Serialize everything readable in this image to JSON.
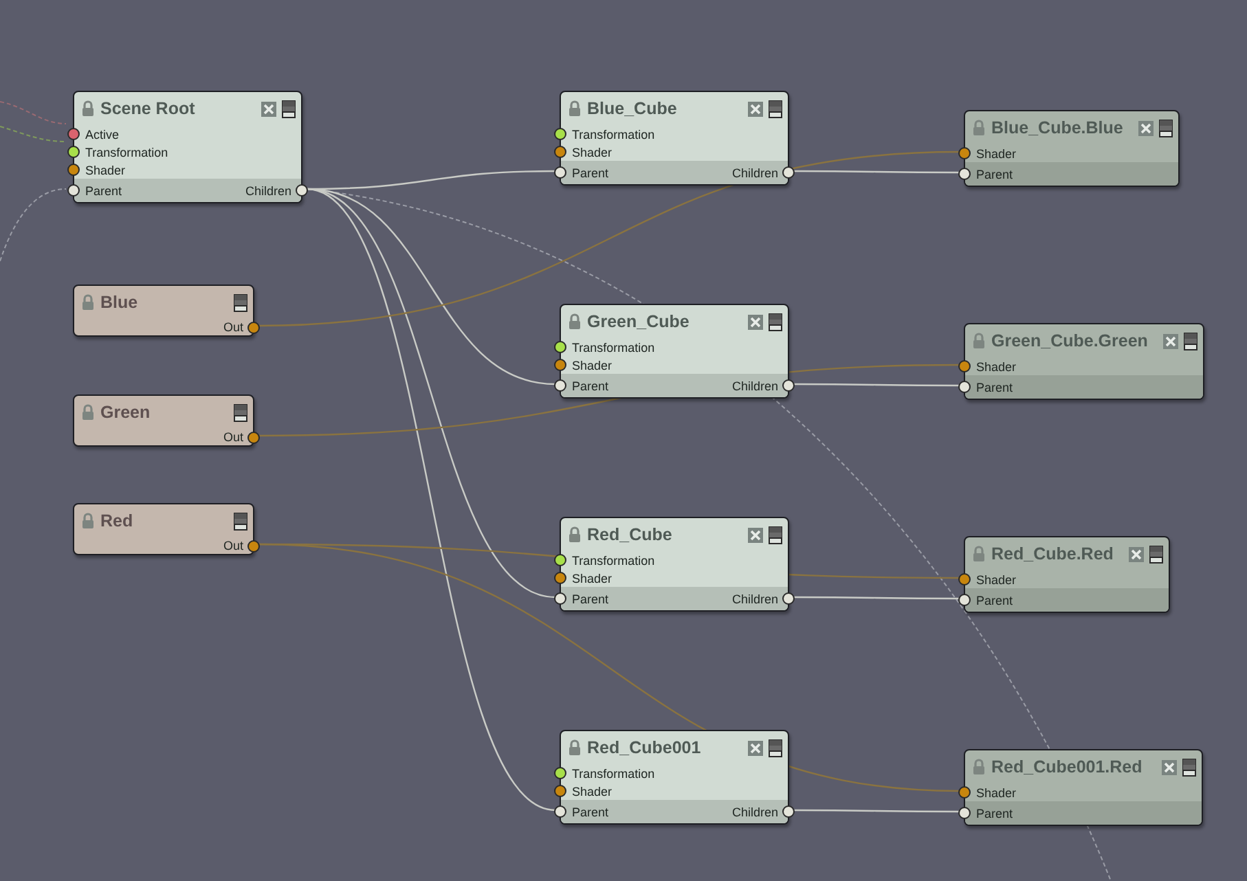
{
  "nodes": [
    {
      "title": "Scene Root",
      "kind": "object",
      "closable": true,
      "inputs": [
        {
          "name": "Active",
          "color": "#d9646e"
        },
        {
          "name": "Transformation",
          "color": "#a8e04a"
        },
        {
          "name": "Shader",
          "color": "#c8860e"
        }
      ],
      "footer": {
        "input": "Parent",
        "output": "Children"
      }
    },
    {
      "title": "Blue",
      "kind": "color",
      "closable": false,
      "output": {
        "name": "Out",
        "color": "#c8860e"
      }
    },
    {
      "title": "Green",
      "kind": "color",
      "closable": false,
      "output": {
        "name": "Out",
        "color": "#c8860e"
      }
    },
    {
      "title": "Red",
      "kind": "color",
      "closable": false,
      "output": {
        "name": "Out",
        "color": "#c8860e"
      }
    },
    {
      "title": "Blue_Cube",
      "kind": "object",
      "closable": true,
      "inputs": [
        {
          "name": "Transformation",
          "color": "#a8e04a"
        },
        {
          "name": "Shader",
          "color": "#c8860e"
        }
      ],
      "footer": {
        "input": "Parent",
        "output": "Children"
      }
    },
    {
      "title": "Green_Cube",
      "kind": "object",
      "closable": true,
      "inputs": [
        {
          "name": "Transformation",
          "color": "#a8e04a"
        },
        {
          "name": "Shader",
          "color": "#c8860e"
        }
      ],
      "footer": {
        "input": "Parent",
        "output": "Children"
      }
    },
    {
      "title": "Red_Cube",
      "kind": "object",
      "closable": true,
      "inputs": [
        {
          "name": "Transformation",
          "color": "#a8e04a"
        },
        {
          "name": "Shader",
          "color": "#c8860e"
        }
      ],
      "footer": {
        "input": "Parent",
        "output": "Children"
      }
    },
    {
      "title": "Red_Cube001",
      "kind": "object",
      "closable": true,
      "inputs": [
        {
          "name": "Transformation",
          "color": "#a8e04a"
        },
        {
          "name": "Shader",
          "color": "#c8860e"
        }
      ],
      "footer": {
        "input": "Parent",
        "output": "Children"
      }
    },
    {
      "title": "Blue_Cube.Blue",
      "kind": "material",
      "closable": true,
      "inputs": [
        {
          "name": "Shader",
          "color": "#c8860e"
        }
      ],
      "footer": {
        "input": "Parent"
      }
    },
    {
      "title": "Green_Cube.Green",
      "kind": "material",
      "closable": true,
      "inputs": [
        {
          "name": "Shader",
          "color": "#c8860e"
        }
      ],
      "footer": {
        "input": "Parent"
      }
    },
    {
      "title": "Red_Cube.Red",
      "kind": "material",
      "closable": true,
      "inputs": [
        {
          "name": "Shader",
          "color": "#c8860e"
        }
      ],
      "footer": {
        "input": "Parent"
      }
    },
    {
      "title": "Red_Cube001.Red",
      "kind": "material",
      "closable": true,
      "inputs": [
        {
          "name": "Shader",
          "color": "#c8860e"
        }
      ],
      "footer": {
        "input": "Parent"
      }
    }
  ]
}
